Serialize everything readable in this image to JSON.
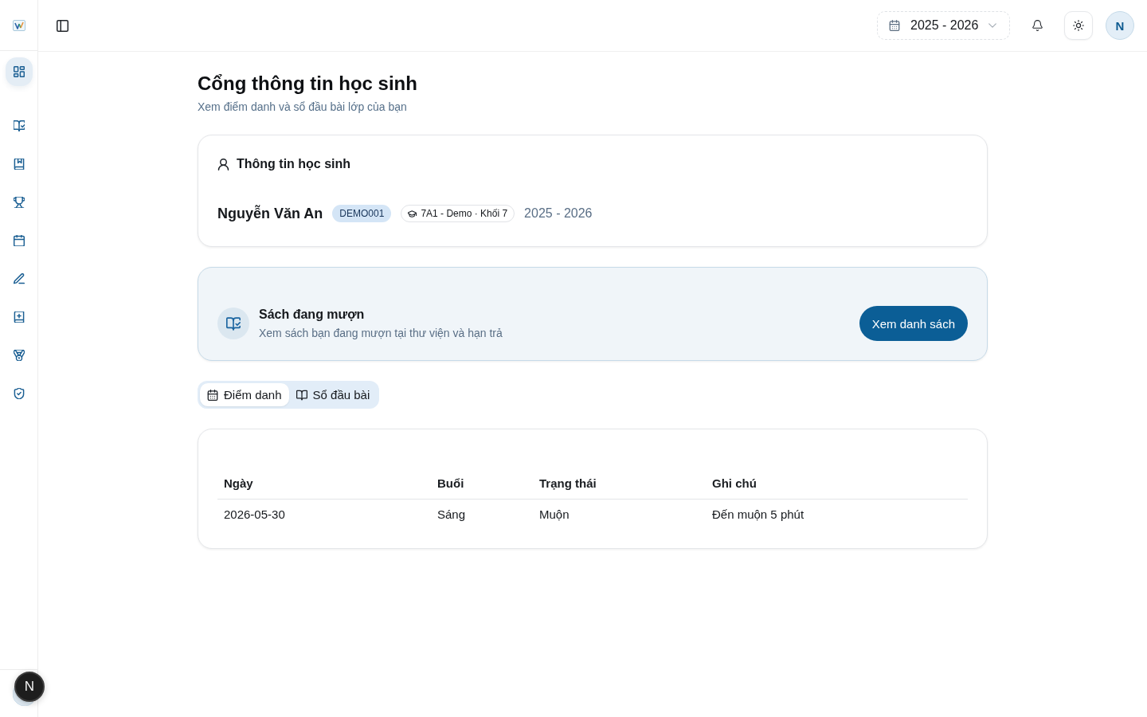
{
  "sidebar": {
    "groups": [
      {
        "items": [
          {
            "selected": true
          }
        ]
      },
      {
        "items": [
          {
            "selected": false
          },
          {
            "selected": false
          },
          {
            "selected": false
          },
          {
            "selected": false
          },
          {
            "selected": false
          },
          {
            "selected": false
          },
          {
            "selected": false
          },
          {
            "selected": false
          }
        ]
      }
    ]
  },
  "header": {
    "year_select": {
      "value": "2025 - 2026"
    },
    "avatar": {
      "initial": "N"
    }
  },
  "page": {
    "title": "Cổng thông tin học sinh",
    "subtitle": "Xem điểm danh và sổ đầu bài lớp của bạn"
  },
  "student_card": {
    "heading": "Thông tin học sinh",
    "name": "Nguyễn Văn An",
    "student_code": "DEMO001",
    "class_chip": "7A1 - Demo · Khối 7",
    "school_year": "2025 - 2026"
  },
  "library_card": {
    "title": "Sách đang mượn",
    "description": "Xem sách bạn đang mượn tại thư viện và hạn trả",
    "button": "Xem danh sách"
  },
  "tabs": [
    {
      "label": "Điểm danh",
      "selected": true
    },
    {
      "label": "Sổ đầu bài",
      "selected": false
    }
  ],
  "attendance_table": {
    "columns": [
      "Ngày",
      "Buổi",
      "Trạng thái",
      "Ghi chú"
    ],
    "rows": [
      [
        "2026-05-30",
        "Sáng",
        "Muộn",
        "Đến muộn 5 phút"
      ]
    ]
  },
  "dev_indicator": {
    "label": "N"
  }
}
